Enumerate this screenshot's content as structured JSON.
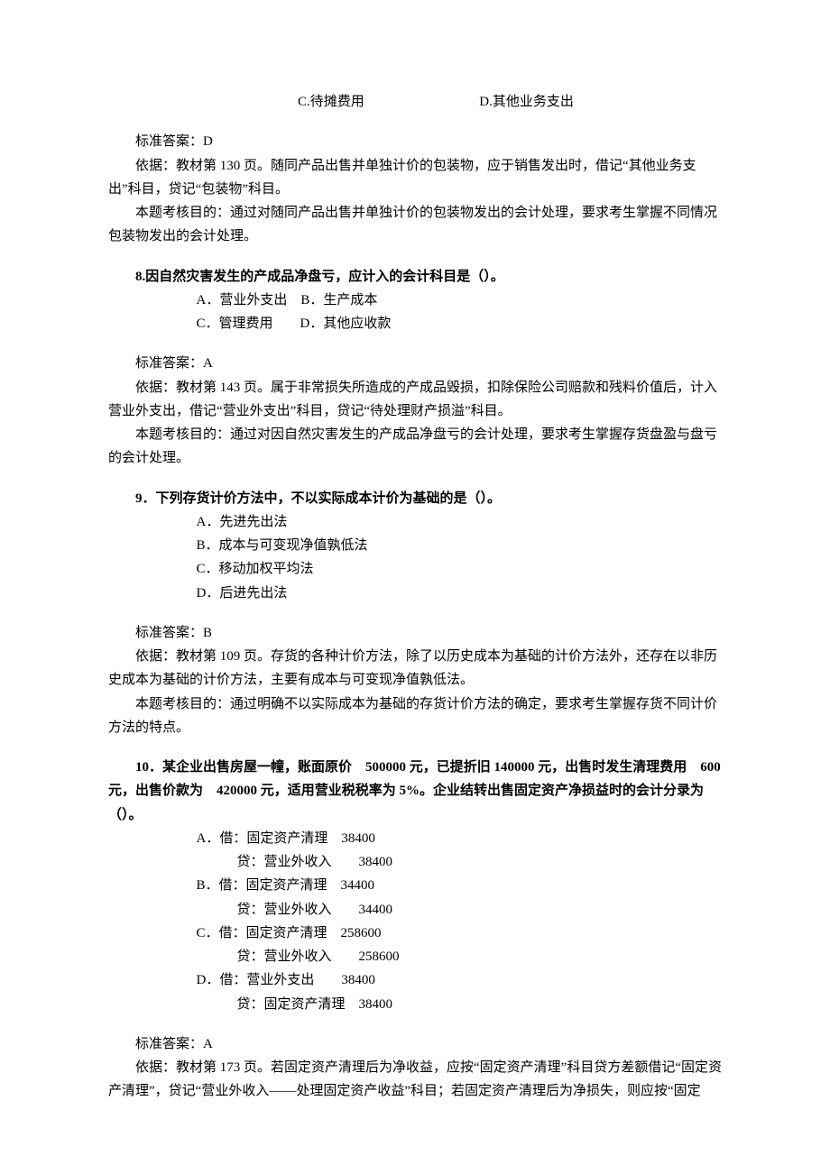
{
  "q7_tail_options": {
    "c": "C.待摊费用",
    "d": "D.其他业务支出"
  },
  "q7_ans": {
    "label": "标准答案：D",
    "basis": "依据：教材第 130 页。随同产品出售并单独计价的包装物，应于销售发出时，借记“其他业务支出”科目，贷记“包装物”科目。",
    "purpose": "本题考核目的：通过对随同产品出售并单独计价的包装物发出的会计处理，要求考生掌握不同情况包装物发出的会计处理。"
  },
  "q8": {
    "stem": "8.因自然灾害发生的产成品净盘亏，应计入的会计科目是（）。",
    "opt_line1": "A．营业外支出　B．生产成本",
    "opt_line2": "C．管理费用　　D．其他应收款",
    "ans_label": "标准答案：A",
    "basis": "依据：教材第 143 页。属于非常损失所造成的产成品毁损，扣除保险公司赔款和残料价值后，计入营业外支出，借记“营业外支出”科目，贷记“待处理财产损溢”科目。",
    "purpose": "本题考核目的：通过对因自然灾害发生的产成品净盘亏的会计处理，要求考生掌握存货盘盈与盘亏的会计处理。"
  },
  "q9": {
    "stem": "9．下列存货计价方法中，不以实际成本计价为基础的是（）。",
    "a": "A．先进先出法",
    "b": "B．成本与可变现净值孰低法",
    "c": "C．移动加权平均法",
    "d": "D．后进先出法",
    "ans_label": "标准答案：B",
    "basis": "依据：教材第 109 页。存货的各种计价方法，除了以历史成本为基础的计价方法外，还存在以非历史成本为基础的计价方法，主要有成本与可变现净值孰低法。",
    "purpose": "本题考核目的：通过明确不以实际成本为基础的存货计价方法的确定，要求考生掌握存货不同计价方法的特点。"
  },
  "q10": {
    "stem": "10．某企业出售房屋一幢，账面原价　500000 元，已提折旧 140000 元，出售时发生清理费用　600 元，出售价款为　420000 元，适用营业税税率为 5%。企业结转出售固定资产净损益时的会计分录为（）。",
    "a1": "A．借：固定资产清理　38400",
    "a2": "贷：营业外收入　　38400",
    "b1": "B．借：固定资产清理　34400",
    "b2": "贷：营业外收入　　34400",
    "c1": "C．借：固定资产清理　258600",
    "c2": "贷：营业外收入　　258600",
    "d1": "D．借：营业外支出　　38400",
    "d2": "贷：固定资产清理　38400",
    "ans_label": "标准答案：A",
    "basis": "依据：教材第 173 页。若固定资产清理后为净收益，应按“固定资产清理”科目贷方差额借记“固定资产清理”，贷记“营业外收入——处理固定资产收益”科目；若固定资产清理后为净损失，则应按“固定"
  }
}
